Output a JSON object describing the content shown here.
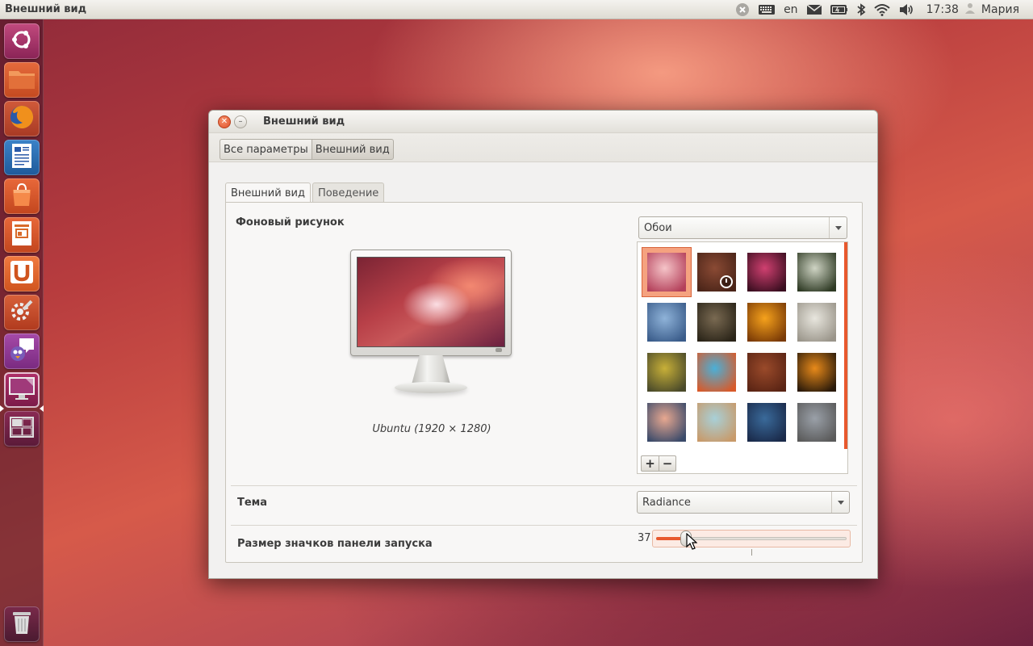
{
  "top_panel": {
    "app_title": "Внешний вид",
    "keyboard_layout": "en",
    "time": "17:38",
    "user": "Мария"
  },
  "launcher": {
    "items": [
      {
        "name": "dash-home",
        "icon": "ubuntu-logo-icon"
      },
      {
        "name": "files",
        "icon": "folder-icon"
      },
      {
        "name": "firefox",
        "icon": "firefox-icon"
      },
      {
        "name": "writer",
        "icon": "document-icon"
      },
      {
        "name": "software-center",
        "icon": "shopping-bag-icon"
      },
      {
        "name": "impress",
        "icon": "presentation-icon"
      },
      {
        "name": "ubuntu-one",
        "icon": "ubuntu-one-icon"
      },
      {
        "name": "system-settings",
        "icon": "settings-wrench-icon"
      },
      {
        "name": "empathy",
        "icon": "chat-icon"
      },
      {
        "name": "appearance",
        "icon": "display-icon"
      },
      {
        "name": "workspace-switcher",
        "icon": "workspace-icon"
      },
      {
        "name": "trash",
        "icon": "trash-icon"
      }
    ]
  },
  "window": {
    "title": "Внешний вид",
    "breadcrumbs": [
      "Все параметры",
      "Внешний вид"
    ],
    "tabs": [
      "Внешний вид",
      "Поведение"
    ],
    "active_tab": 0,
    "background": {
      "label": "Фоновый рисунок",
      "source_select": "Обои",
      "caption": "Ubuntu (1920 × 1280)",
      "add_button": "+",
      "remove_button": "−",
      "selected_index": 0,
      "thumbnails": [
        {
          "name": "wallpaper-ubuntu",
          "colors": [
            "#f5c4c8",
            "#b4405a"
          ]
        },
        {
          "name": "wallpaper-slideshow",
          "colors": [
            "#8a4a34",
            "#4a2418"
          ]
        },
        {
          "name": "wallpaper-flower-pink",
          "colors": [
            "#d04070",
            "#3a0e20"
          ]
        },
        {
          "name": "wallpaper-white-flowers",
          "colors": [
            "#cfd4c4",
            "#2e3a24"
          ]
        },
        {
          "name": "wallpaper-blue-buds",
          "colors": [
            "#8fb3d9",
            "#3a5c8a"
          ]
        },
        {
          "name": "wallpaper-brown-bokeh",
          "colors": [
            "#7a6a52",
            "#2a2418"
          ]
        },
        {
          "name": "wallpaper-orange-flower",
          "colors": [
            "#f6a21c",
            "#7a3a06"
          ]
        },
        {
          "name": "wallpaper-ferris-wheel",
          "colors": [
            "#e8e6de",
            "#9a958a"
          ]
        },
        {
          "name": "wallpaper-yellow-flower",
          "colors": [
            "#c8b038",
            "#4a4a2a"
          ]
        },
        {
          "name": "wallpaper-graffiti",
          "colors": [
            "#4ab0d8",
            "#d85a2a"
          ]
        },
        {
          "name": "wallpaper-brown-lizard",
          "colors": [
            "#9a4a2a",
            "#5a2414"
          ]
        },
        {
          "name": "wallpaper-orange-circle",
          "colors": [
            "#e88a1a",
            "#2a1a0a"
          ]
        },
        {
          "name": "wallpaper-sunset",
          "colors": [
            "#e8a890",
            "#3a4a6a"
          ]
        },
        {
          "name": "wallpaper-bridge",
          "colors": [
            "#a8d0d8",
            "#c89a6a"
          ]
        },
        {
          "name": "wallpaper-blue-tiles",
          "colors": [
            "#3a6a9a",
            "#1a2a4a"
          ]
        },
        {
          "name": "wallpaper-grey-branch",
          "colors": [
            "#9aa0a8",
            "#5a5a5a"
          ]
        }
      ]
    },
    "theme": {
      "label": "Тема",
      "value": "Radiance"
    },
    "launcher_icon_size": {
      "label": "Размер значков панели запуска",
      "value": 37,
      "min": 32,
      "max": 64
    }
  },
  "colors": {
    "accent": "#e8582d",
    "window_bg": "#f2f1f0"
  }
}
